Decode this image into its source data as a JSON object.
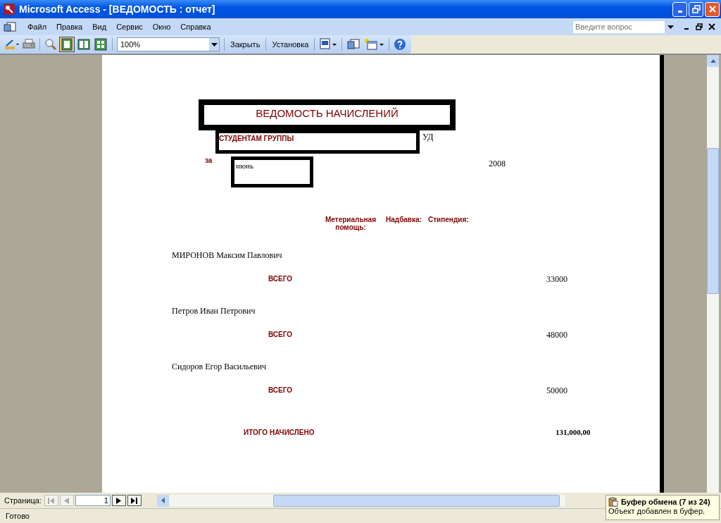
{
  "window": {
    "title": "Microsoft Access - [ВЕДОМОСТЬ : отчет]"
  },
  "menu": [
    "Файл",
    "Правка",
    "Вид",
    "Сервис",
    "Окно",
    "Справка"
  ],
  "question": {
    "placeholder": "Введите вопрос"
  },
  "toolbar": {
    "zoom": "100%",
    "buttons": [
      "Закрыть",
      "Установка"
    ]
  },
  "report": {
    "title": "ВЕДОМОСТЬ НАЧИСЛЕНИЙ",
    "group_label": "СТУДЕНТАМ ГРУППЫ",
    "group": "УД",
    "period_label": "за",
    "month": "июнь",
    "year": "2008",
    "columns": [
      "Метериальная помощь:",
      "Надбавка:",
      "Стипендия:"
    ],
    "students": [
      {
        "name": "МИРОНОВ Максим Павлович",
        "total_label": "ВСЕГО",
        "total": "33000"
      },
      {
        "name": "Петров Иван Петрович",
        "total_label": "ВСЕГО",
        "total": "48000"
      },
      {
        "name": "Сидоров Егор Васильевич",
        "total_label": "ВСЕГО",
        "total": "50000"
      }
    ],
    "grand_total_label": "ИТОГО НАЧИСЛЕНО",
    "grand_total": "131,000,00"
  },
  "navigator": {
    "label": "Страница:",
    "page": "1"
  },
  "status_bar": {
    "text": "Готово"
  },
  "clipboard": {
    "title": "Буфер обмена (7 из 24)",
    "message": "Объект добавлен в буфер."
  }
}
